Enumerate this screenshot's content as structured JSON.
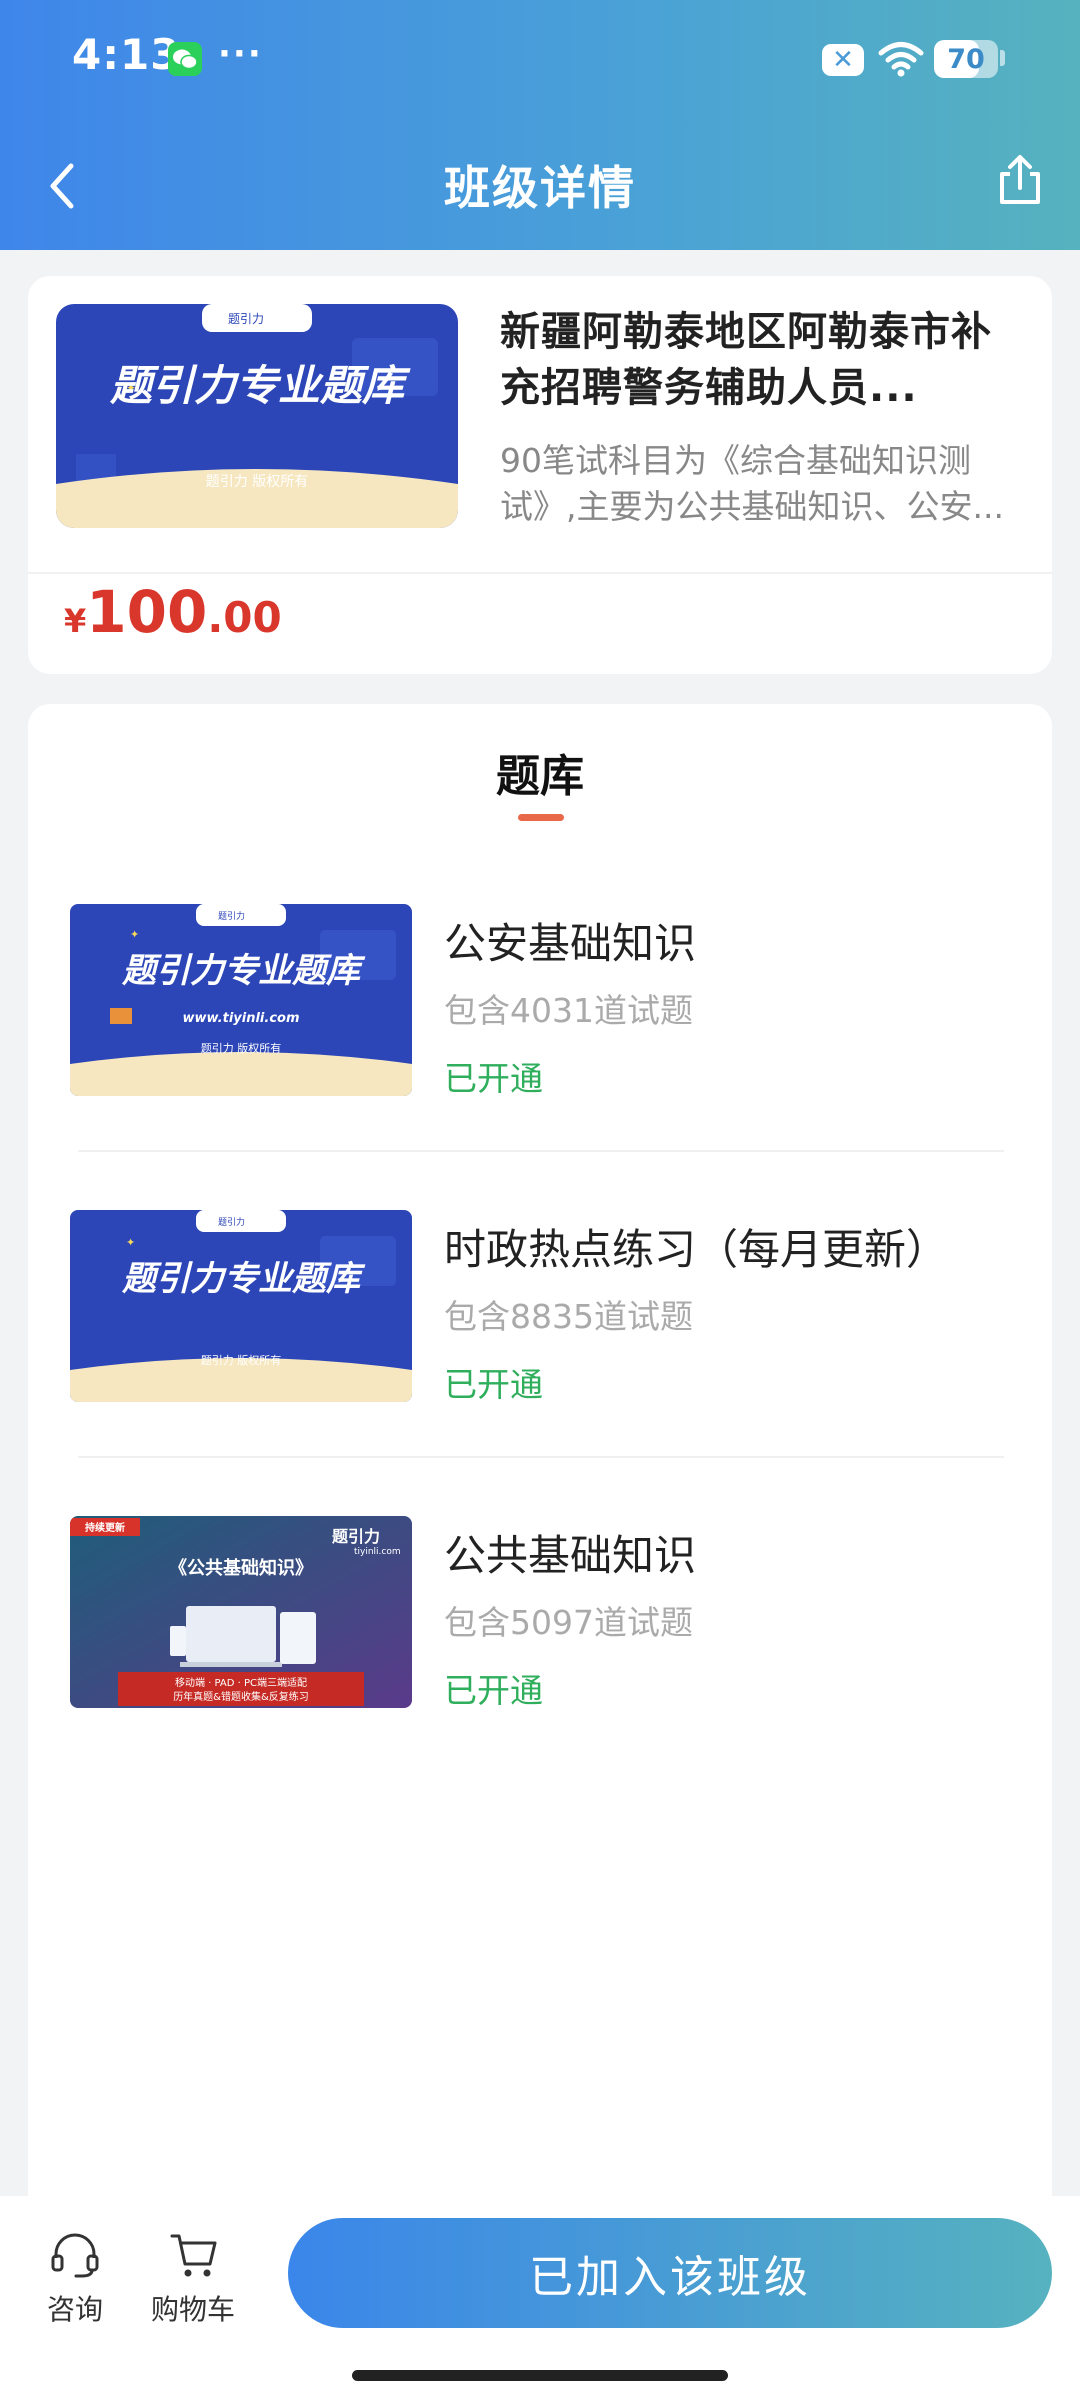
{
  "status_bar": {
    "time": "4:13",
    "dots": "···",
    "battery": "70",
    "battery_level": 0.7
  },
  "nav": {
    "title": "班级详情"
  },
  "course": {
    "cover_brand": "题引力",
    "cover_title": "题引力专业题库",
    "cover_copyright": "题引力 版权所有",
    "title": "新疆阿勒泰地区阿勒泰市补充招聘警务辅助人员...",
    "description": "90笔试科目为《综合基础知识测试》,主要为公共基础知识、公安...",
    "price_symbol": "¥",
    "price_int": "100",
    "price_dec": ".00"
  },
  "section": {
    "title": "题库"
  },
  "items": [
    {
      "title": "公安基础知识",
      "count": "包含4031道试题",
      "status": "已开通",
      "cover_brand": "题引力",
      "cover_title": "题引力专业题库",
      "cover_url": "www.tiyinli.com",
      "cover_copyright": "题引力 版权所有"
    },
    {
      "title": "时政热点练习（每月更新）",
      "count": "包含8835道试题",
      "status": "已开通",
      "cover_brand": "题引力",
      "cover_title": "题引力专业题库",
      "cover_copyright": "题引力 版权所有"
    },
    {
      "title": "公共基础知识",
      "count": "包含5097道试题",
      "status": "已开通",
      "cover_tag": "持续更新",
      "cover_logo": "题引力",
      "cover_site": "tiyinli.com",
      "cover_title": "《公共基础知识》",
      "cover_line1": "移动端 · PAD · PC端三端适配",
      "cover_line2": "历年真题&错题收集&反复练习"
    }
  ],
  "bottom": {
    "consult_label": "咨询",
    "cart_label": "购物车",
    "join_label": "已加入该班级"
  },
  "colors": {
    "header_start": "#3f86ea",
    "header_end": "#56b2be",
    "price": "#d9372b",
    "status_green": "#2fae5c",
    "underline": "#e9684a"
  }
}
